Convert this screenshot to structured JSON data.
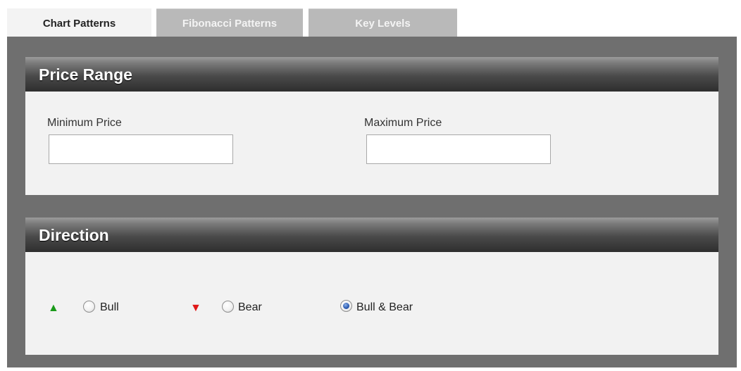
{
  "tabs": [
    {
      "label": "Chart Patterns",
      "active": true
    },
    {
      "label": "Fibonacci Patterns",
      "active": false
    },
    {
      "label": "Key Levels",
      "active": false
    }
  ],
  "price_range": {
    "title": "Price Range",
    "min_label": "Minimum Price",
    "min_value": "",
    "max_label": "Maximum Price",
    "max_value": ""
  },
  "direction": {
    "title": "Direction",
    "options": [
      {
        "label": "Bull",
        "icon": "up-arrow-icon",
        "icon_color": "#1a9a1a",
        "checked": false
      },
      {
        "label": "Bear",
        "icon": "down-arrow-icon",
        "icon_color": "#e01818",
        "checked": false
      },
      {
        "label": "Bull & Bear",
        "checked": true
      }
    ]
  },
  "colors": {
    "panel_bg": "#6f6f6f",
    "section_bg": "#f2f2f2",
    "tab_inactive_bg": "#b9b9b9",
    "header_dark": "#2e2e2e"
  }
}
